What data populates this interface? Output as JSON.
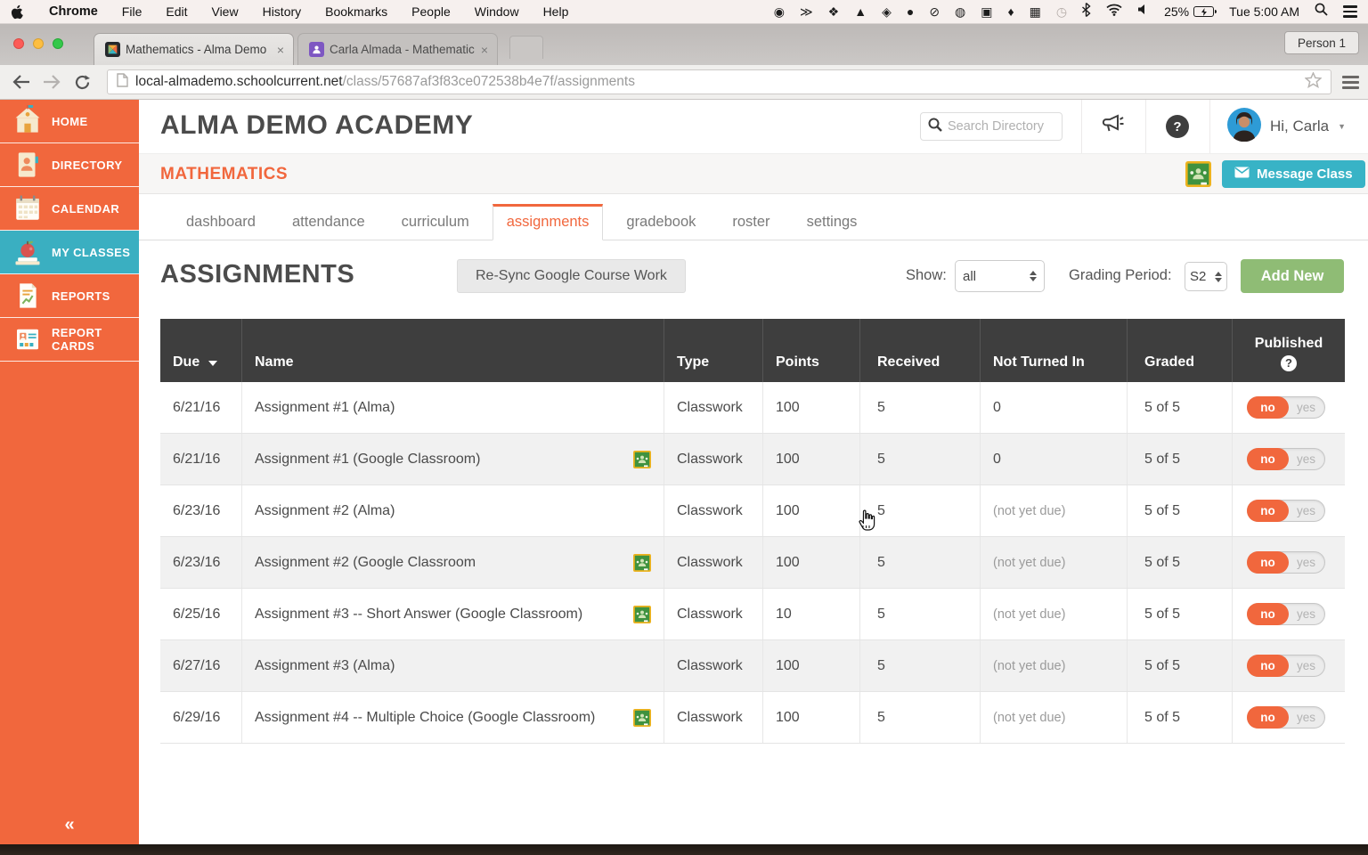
{
  "menubar": {
    "items": [
      "Chrome",
      "File",
      "Edit",
      "View",
      "History",
      "Bookmarks",
      "People",
      "Window",
      "Help"
    ],
    "status_icons": [
      {
        "name": "screen-record-icon",
        "glyph": "◉"
      },
      {
        "name": "chevrons-icon",
        "glyph": "≫"
      },
      {
        "name": "dropbox-icon",
        "glyph": "❖"
      },
      {
        "name": "drive-icon",
        "glyph": "▲"
      },
      {
        "name": "diamond-icon",
        "glyph": "◈"
      },
      {
        "name": "bell-icon",
        "glyph": "●"
      },
      {
        "name": "slash-circle-icon",
        "glyph": "⊘"
      },
      {
        "name": "globe-icon",
        "glyph": "◍"
      },
      {
        "name": "elephant-app-icon",
        "glyph": "▣"
      },
      {
        "name": "flame-icon",
        "glyph": "♦"
      },
      {
        "name": "keyboard-icon",
        "glyph": "▦"
      },
      {
        "name": "time-machine-icon",
        "glyph": "◷",
        "dim": true
      }
    ],
    "battery_percent": "25%",
    "clock": "Tue 5:00 AM"
  },
  "browser": {
    "profile_button": "Person 1",
    "tabs": [
      {
        "title": "Mathematics - Alma Demo"
      },
      {
        "title": "Carla Almada - Mathematic"
      }
    ],
    "close_glyph": "×",
    "url": {
      "host": "local-almademo.schoolcurrent.net",
      "path": "/class/57687af3f83ce072538b4e7f/assignments"
    }
  },
  "sidebar": {
    "items": [
      {
        "label": "HOME"
      },
      {
        "label": "DIRECTORY"
      },
      {
        "label": "CALENDAR"
      },
      {
        "label": "MY CLASSES"
      },
      {
        "label": "REPORTS"
      },
      {
        "label": "REPORT CARDS"
      }
    ],
    "collapse_glyph": "«"
  },
  "header": {
    "school_name": "ALMA DEMO ACADEMY",
    "search_placeholder": "Search Directory",
    "greeting": "Hi, Carla"
  },
  "classbar": {
    "class_name": "MATHEMATICS",
    "message_button": "Message Class"
  },
  "nav_tabs": [
    {
      "label": "dashboard"
    },
    {
      "label": "attendance"
    },
    {
      "label": "curriculum"
    },
    {
      "label": "assignments",
      "active": true
    },
    {
      "label": "gradebook"
    },
    {
      "label": "roster"
    },
    {
      "label": "settings"
    }
  ],
  "assignments": {
    "title": "ASSIGNMENTS",
    "resync_button": "Re-Sync Google Course Work",
    "show_label": "Show:",
    "show_value": "all",
    "grading_period_label": "Grading Period:",
    "grading_period_value": "S2",
    "add_new_button": "Add New"
  },
  "table": {
    "headers": {
      "due": "Due",
      "name": "Name",
      "type": "Type",
      "points": "Points",
      "received": "Received",
      "not_turned_in": "Not Turned In",
      "graded": "Graded",
      "published": "Published"
    },
    "toggle": {
      "on": "no",
      "off": "yes"
    },
    "rows": [
      {
        "due": "6/21/16",
        "name": "Assignment #1 (Alma)",
        "google": false,
        "type": "Classwork",
        "points": "100",
        "received": "5",
        "not_turned_in": "0",
        "graded": "5 of 5",
        "published": "no"
      },
      {
        "due": "6/21/16",
        "name": "Assignment #1 (Google Classroom)",
        "google": true,
        "type": "Classwork",
        "points": "100",
        "received": "5",
        "not_turned_in": "0",
        "graded": "5 of 5",
        "published": "no"
      },
      {
        "due": "6/23/16",
        "name": "Assignment #2 (Alma)",
        "google": false,
        "type": "Classwork",
        "points": "100",
        "received": "5",
        "not_turned_in": "(not yet due)",
        "graded": "5 of 5",
        "published": "no"
      },
      {
        "due": "6/23/16",
        "name": "Assignment #2 (Google Classroom",
        "google": true,
        "type": "Classwork",
        "points": "100",
        "received": "5",
        "not_turned_in": "(not yet due)",
        "graded": "5 of 5",
        "published": "no"
      },
      {
        "due": "6/25/16",
        "name": "Assignment #3 -- Short Answer (Google Classroom)",
        "google": true,
        "type": "Classwork",
        "points": "10",
        "received": "5",
        "not_turned_in": "(not yet due)",
        "graded": "5 of 5",
        "published": "no"
      },
      {
        "due": "6/27/16",
        "name": "Assignment #3 (Alma)",
        "google": false,
        "type": "Classwork",
        "points": "100",
        "received": "5",
        "not_turned_in": "(not yet due)",
        "graded": "5 of 5",
        "published": "no"
      },
      {
        "due": "6/29/16",
        "name": "Assignment #4 -- Multiple Choice (Google Classroom)",
        "google": true,
        "type": "Classwork",
        "points": "100",
        "received": "5",
        "not_turned_in": "(not yet due)",
        "graded": "5 of 5",
        "published": "no"
      }
    ]
  },
  "colors": {
    "accent_orange": "#f1673d",
    "sidebar_active_teal": "#3aafc1",
    "message_teal": "#38b3c6",
    "add_new_green": "#8fbc75",
    "table_header_dark": "#3e3e3e"
  }
}
